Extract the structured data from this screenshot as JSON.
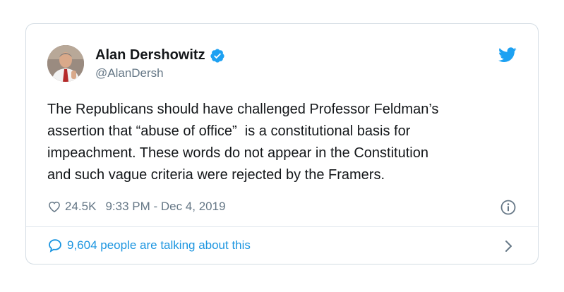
{
  "tweet": {
    "display_name": "Alan Dershowitz",
    "handle": "@AlanDersh",
    "text": "The Republicans should have challenged Professor Feldman’s\nassertion that “abuse of office”  is a constitutional basis for\nimpeachment. These words do not appear in the Constitution\nand such vague criteria were rejected by the Framers.",
    "likes": "24.5K",
    "timestamp": "9:33 PM - Dec 4, 2019",
    "talking_about": "9,604 people are talking about this"
  },
  "icons": {
    "avatar": "profile-photo",
    "verified": "verified-badge-icon",
    "brand": "twitter-bird-icon",
    "like": "heart-icon",
    "info": "info-icon",
    "reply": "speech-bubble-icon",
    "more": "chevron-right-icon"
  },
  "colors": {
    "link_blue": "#1b95e0",
    "twitter_blue": "#1da1f2",
    "text_primary": "#14171a",
    "text_secondary": "#657786",
    "border": "#d3dce3"
  }
}
